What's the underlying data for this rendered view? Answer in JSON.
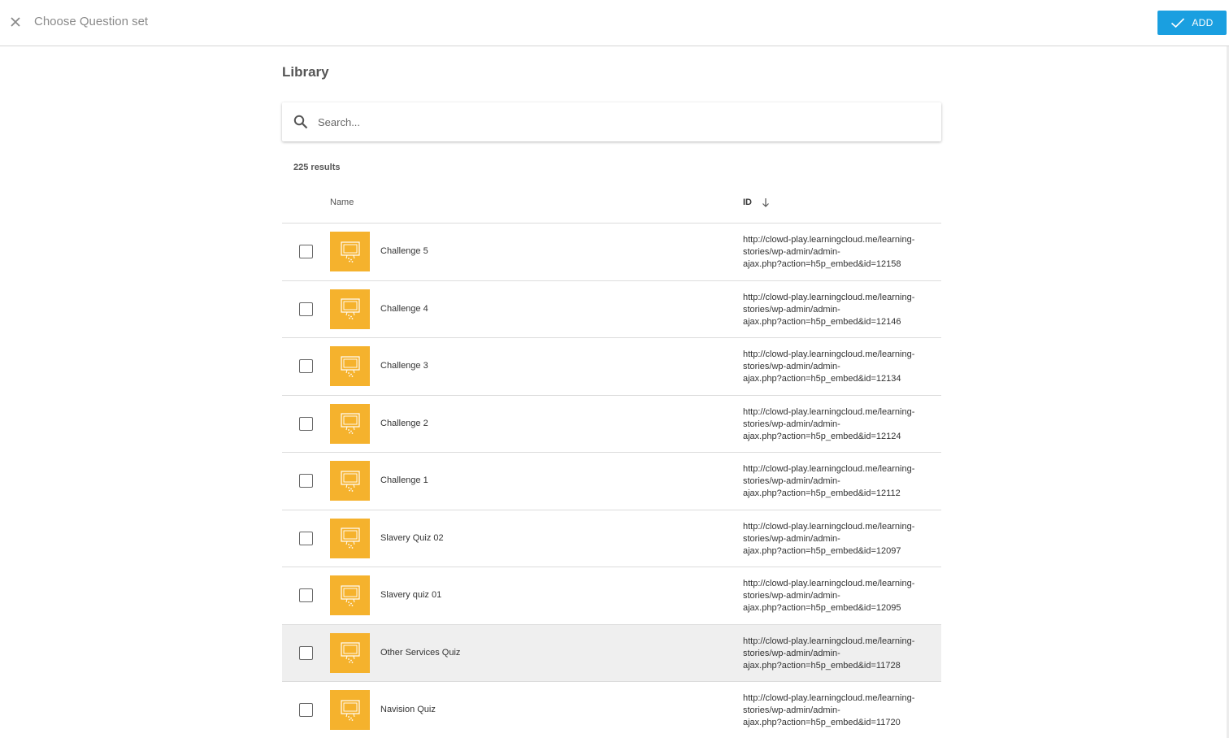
{
  "header": {
    "title": "Choose Question set",
    "close_icon": "close-icon",
    "add_label": "ADD",
    "add_icon": "check-icon",
    "accent_color": "#1a9fe0"
  },
  "library": {
    "title": "Library",
    "search": {
      "placeholder": "Search...",
      "value": ""
    },
    "results_count": "225 results",
    "columns": {
      "name": "Name",
      "id": "ID",
      "sort_icon": "arrow-down-icon"
    },
    "thumbnail_color": "#f5b22d",
    "items": [
      {
        "name": "Challenge 5",
        "id_lines": [
          "http://clowd-play.learningcloud.me/learning-",
          "stories/wp-admin/admin-",
          "ajax.php?action=h5p_embed&id=12158"
        ]
      },
      {
        "name": "Challenge 4",
        "id_lines": [
          "http://clowd-play.learningcloud.me/learning-",
          "stories/wp-admin/admin-",
          "ajax.php?action=h5p_embed&id=12146"
        ]
      },
      {
        "name": "Challenge 3",
        "id_lines": [
          "http://clowd-play.learningcloud.me/learning-",
          "stories/wp-admin/admin-",
          "ajax.php?action=h5p_embed&id=12134"
        ]
      },
      {
        "name": "Challenge 2",
        "id_lines": [
          "http://clowd-play.learningcloud.me/learning-",
          "stories/wp-admin/admin-",
          "ajax.php?action=h5p_embed&id=12124"
        ]
      },
      {
        "name": "Challenge 1",
        "id_lines": [
          "http://clowd-play.learningcloud.me/learning-",
          "stories/wp-admin/admin-",
          "ajax.php?action=h5p_embed&id=12112"
        ]
      },
      {
        "name": "Slavery Quiz 02",
        "id_lines": [
          "http://clowd-play.learningcloud.me/learning-",
          "stories/wp-admin/admin-",
          "ajax.php?action=h5p_embed&id=12097"
        ]
      },
      {
        "name": "Slavery quiz 01",
        "id_lines": [
          "http://clowd-play.learningcloud.me/learning-",
          "stories/wp-admin/admin-",
          "ajax.php?action=h5p_embed&id=12095"
        ]
      },
      {
        "name": "Other Services Quiz",
        "id_lines": [
          "http://clowd-play.learningcloud.me/learning-",
          "stories/wp-admin/admin-",
          "ajax.php?action=h5p_embed&id=11728"
        ]
      },
      {
        "name": "Navision Quiz",
        "id_lines": [
          "http://clowd-play.learningcloud.me/learning-",
          "stories/wp-admin/admin-",
          "ajax.php?action=h5p_embed&id=11720"
        ]
      }
    ]
  }
}
